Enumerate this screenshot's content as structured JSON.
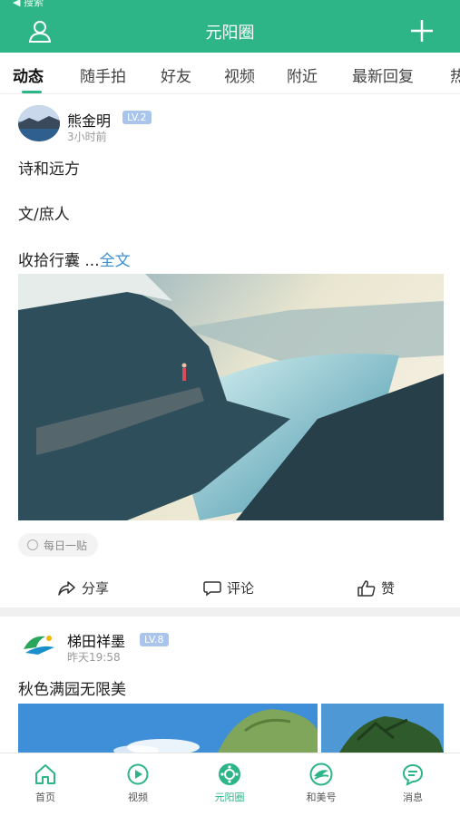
{
  "status": {
    "back_label": "◀ 搜索"
  },
  "header": {
    "title": "元阳圈"
  },
  "tabs": [
    {
      "label": "动态",
      "active": true
    },
    {
      "label": "随手拍"
    },
    {
      "label": "好友"
    },
    {
      "label": "视频"
    },
    {
      "label": "附近"
    },
    {
      "label": "最新回复"
    },
    {
      "label": "热"
    }
  ],
  "posts": [
    {
      "author": "熊金明",
      "level": "LV.2",
      "time": "3小时前",
      "lines": [
        "诗和远方",
        "文/庶人"
      ],
      "last_line": "收拾行囊 ...",
      "more": "全文",
      "tag": "每日一贴",
      "actions": {
        "share": "分享",
        "comment": "评论",
        "like": "赞"
      }
    },
    {
      "author": "梯田祥墨",
      "level": "LV.8",
      "time": "昨天19:58",
      "lines": [
        "秋色满园无限美"
      ]
    }
  ],
  "bottom_nav": [
    {
      "label": "首页",
      "icon": "home-icon"
    },
    {
      "label": "视频",
      "icon": "video-icon"
    },
    {
      "label": "元阳圈",
      "icon": "circle-icon",
      "active": true
    },
    {
      "label": "和美号",
      "icon": "brand-icon"
    },
    {
      "label": "消息",
      "icon": "message-icon"
    }
  ],
  "colors": {
    "brand": "#2db587",
    "level_badge": "#a9c5ec",
    "link": "#3b8ed6"
  }
}
